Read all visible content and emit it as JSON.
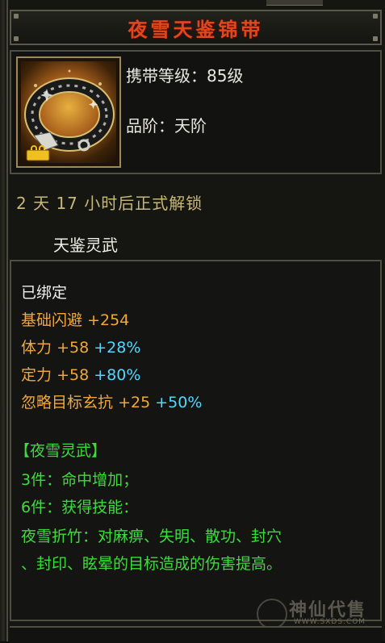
{
  "tooltip": {
    "title": "夜雪天鉴锦带",
    "requirement_label": "携带等级：85级",
    "grade_label": "品阶：天阶",
    "unlock_text": "2 天 17 小时后正式解锁",
    "item_subname": "天鉴灵武",
    "bound_status": "已绑定",
    "stats": [
      {
        "name": "基础闪避",
        "flat": "+254",
        "pct": ""
      },
      {
        "name": "体力",
        "flat": "+58",
        "pct": "+28%"
      },
      {
        "name": "定力",
        "flat": "+58",
        "pct": "+80%"
      },
      {
        "name": "忽略目标玄抗",
        "flat": "+25",
        "pct": "+50%"
      }
    ],
    "set_name": "【夜雪灵武】",
    "set_bonus_3": "3件：命中增加；",
    "set_bonus_6": "6件：获得技能：",
    "skill_line_1": "夜雪折竹：对麻痹、失明、散功、封穴",
    "skill_line_2": "、封印、眩晕的目标造成的伤害提高。"
  },
  "watermark": {
    "text": "神仙代售",
    "url": "WWW.SXDS.COM"
  },
  "colors": {
    "title": "#e0481c",
    "stat": "#f0a83a",
    "bonus": "#52d8ff",
    "set": "#3cdc3c"
  },
  "icon": {
    "name": "belt-icon"
  }
}
